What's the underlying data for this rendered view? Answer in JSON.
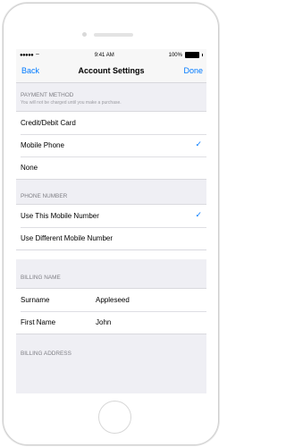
{
  "status_bar": {
    "signal": "●●●●●",
    "wifi_icon": "wifi-icon",
    "time": "9:41 AM",
    "battery_text": "100%"
  },
  "nav": {
    "back": "Back",
    "title": "Account Settings",
    "done": "Done"
  },
  "payment": {
    "header": "PAYMENT METHOD",
    "note": "You will not be charged until you make a purchase.",
    "options": [
      {
        "label": "Credit/Debit Card",
        "selected": false
      },
      {
        "label": "Mobile Phone",
        "selected": true
      },
      {
        "label": "None",
        "selected": false
      }
    ]
  },
  "phone_number": {
    "header": "PHONE NUMBER",
    "options": [
      {
        "label": "Use This Mobile Number",
        "selected": true
      },
      {
        "label": "Use Different Mobile Number",
        "selected": false
      }
    ]
  },
  "billing_name": {
    "header": "BILLING NAME",
    "fields": [
      {
        "label": "Surname",
        "value": "Appleseed"
      },
      {
        "label": "First Name",
        "value": "John"
      }
    ]
  },
  "billing_address": {
    "header": "BILLING ADDRESS"
  },
  "colors": {
    "accent": "#007aff",
    "background": "#efeff4"
  }
}
